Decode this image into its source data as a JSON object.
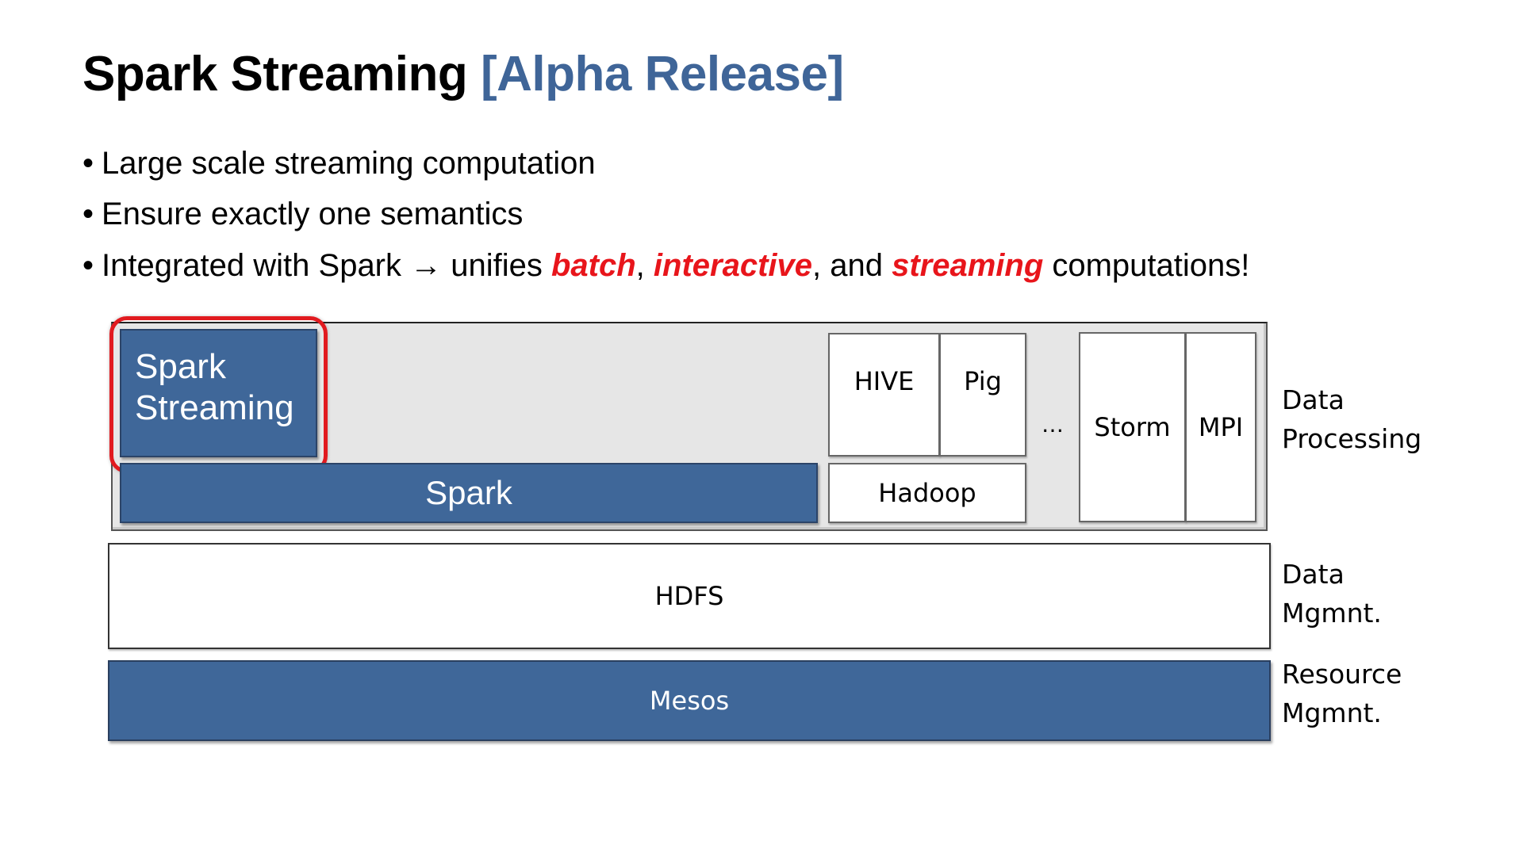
{
  "slide": {
    "title": {
      "main": "Spark Streaming",
      "accent": "[Alpha Release]",
      "accent_color": "#3f6598"
    },
    "bullets": [
      {
        "text": "Large scale streaming computation"
      },
      {
        "text": "Ensure exactly one semantics"
      },
      {
        "segments": [
          {
            "text": "Integrated with Spark → unifies ",
            "emphasis": false
          },
          {
            "text": "batch",
            "emphasis": true
          },
          {
            "text": ", ",
            "emphasis": false
          },
          {
            "text": "interactive",
            "emphasis": true
          },
          {
            "text": ", and ",
            "emphasis": false
          },
          {
            "text": "streaming",
            "emphasis": true
          },
          {
            "text": " computations!",
            "emphasis": false
          }
        ]
      }
    ],
    "bullet_glyph": "•",
    "emphasis_color": "#e8151b"
  },
  "diagram": {
    "highlight_color": "#e11a1f",
    "blue_color": "#3f6799",
    "blocks": {
      "spark_streaming": {
        "line1": "Spark",
        "line2": "Streaming",
        "highlighted": true
      },
      "spark": "Spark",
      "hive": "HIVE",
      "pig": "Pig",
      "hadoop": "Hadoop",
      "ellipsis": "…",
      "storm": "Storm",
      "mpi": "MPI",
      "hdfs": "HDFS",
      "mesos": "Mesos"
    },
    "layers": [
      {
        "line1": "Data",
        "line2": "Processing"
      },
      {
        "line1": "Data",
        "line2": "Mgmnt."
      },
      {
        "line1": "Resource",
        "line2": "Mgmnt."
      }
    ]
  }
}
